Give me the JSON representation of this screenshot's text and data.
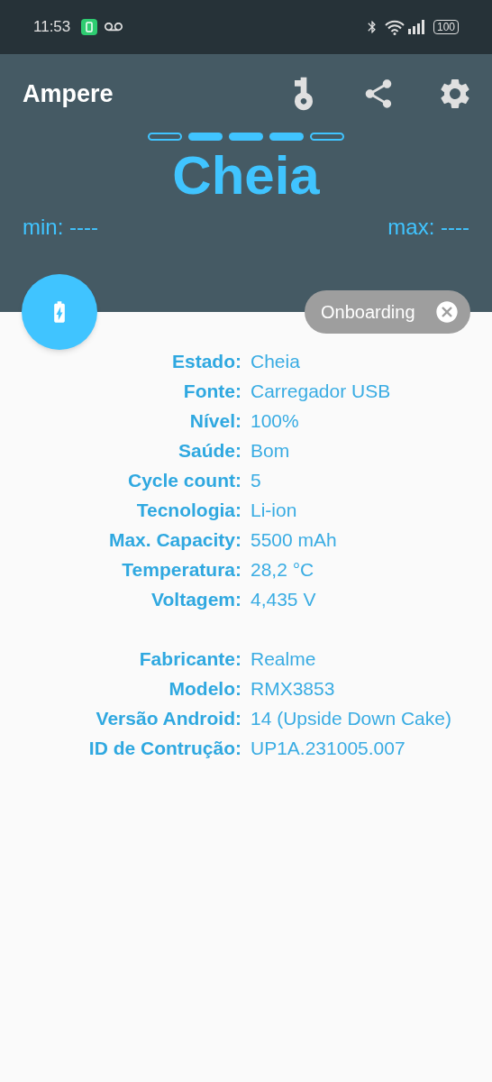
{
  "status_bar": {
    "time": "11:53",
    "battery": "100"
  },
  "app_bar": {
    "title": "Ampere"
  },
  "level_segments": [
    {
      "on": false
    },
    {
      "on": true
    },
    {
      "on": true
    },
    {
      "on": true
    },
    {
      "on": false
    }
  ],
  "state": "Cheia",
  "min": "min: ----",
  "max": "max: ----",
  "chip": {
    "label": "Onboarding"
  },
  "groups": [
    {
      "rows": [
        {
          "label": "Estado:",
          "value": "Cheia"
        },
        {
          "label": "Fonte:",
          "value": "Carregador USB"
        },
        {
          "label": "Nível:",
          "value": "100%"
        },
        {
          "label": "Saúde:",
          "value": "Bom"
        },
        {
          "label": "Cycle count:",
          "value": "5"
        },
        {
          "label": "Tecnologia:",
          "value": "Li-ion"
        },
        {
          "label": "Max. Capacity:",
          "value": "5500 mAh"
        },
        {
          "label": "Temperatura:",
          "value": "28,2 °C"
        },
        {
          "label": "Voltagem:",
          "value": "4,435 V"
        }
      ]
    },
    {
      "rows": [
        {
          "label": "Fabricante:",
          "value": "Realme"
        },
        {
          "label": "Modelo:",
          "value": "RMX3853"
        },
        {
          "label": "Versão Android:",
          "value": "14 (Upside Down Cake)"
        },
        {
          "label": "ID de Contrução:",
          "value": "UP1A.231005.007"
        }
      ]
    }
  ]
}
